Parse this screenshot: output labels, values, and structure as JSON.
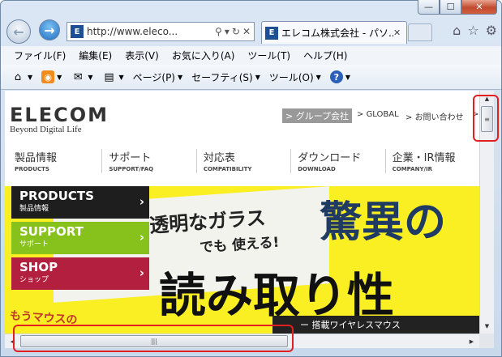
{
  "window": {
    "minimize_glyph": "—",
    "maximize_glyph": "☐",
    "close_glyph": "✕"
  },
  "address_bar": {
    "url": "http://www.eleco...",
    "search_glyph": "⚲",
    "dropdown_glyph": "▾",
    "refresh_glyph": "↻",
    "stop_glyph": "✕"
  },
  "tab": {
    "title": "エレコム株式会社 - パソ...",
    "close_glyph": "✕"
  },
  "right_icons": [
    "home-icon",
    "favorites-star-icon",
    "tools-gear-icon"
  ],
  "menubar": [
    "ファイル(F)",
    "編集(E)",
    "表示(V)",
    "お気に入り(A)",
    "ツール(T)",
    "ヘルプ(H)"
  ],
  "commandbar": {
    "page": "ページ(P)",
    "safety": "セーフティ(S)",
    "tools": "ツール(O)"
  },
  "site": {
    "logo": "ELECOM",
    "tagline": "Beyond Digital Life",
    "group_link": "グループ会社",
    "global_link": "GLOBAL",
    "contact_link": "お問い合わせ",
    "more_link": ">",
    "nav": [
      {
        "jp": "製品情報",
        "en": "PRODUCTS"
      },
      {
        "jp": "サポート",
        "en": "SUPPORT/FAQ"
      },
      {
        "jp": "対応表",
        "en": "COMPATIBILITY"
      },
      {
        "jp": "ダウンロード",
        "en": "DOWNLOAD"
      },
      {
        "jp": "企業・IR情報",
        "en": "COMPANY/IR"
      }
    ],
    "side_buttons": [
      {
        "en": "PRODUCTS",
        "jp": "製品情報",
        "color": "#1e1e1e"
      },
      {
        "en": "SUPPORT",
        "jp": "サポート",
        "color": "#86c21b"
      },
      {
        "en": "SHOP",
        "jp": "ショップ",
        "color": "#b3203f"
      }
    ],
    "hero": {
      "glass": "透明なガラス",
      "use": "でも 使える!",
      "surprise": "驚異の",
      "read": "読み取り性",
      "strip": "ー 搭載ワイヤレスマウス",
      "mouse": "もうマウスの"
    }
  },
  "colors": {
    "highlight": "#e2201f",
    "hero_yellow": "#f9ef22"
  }
}
